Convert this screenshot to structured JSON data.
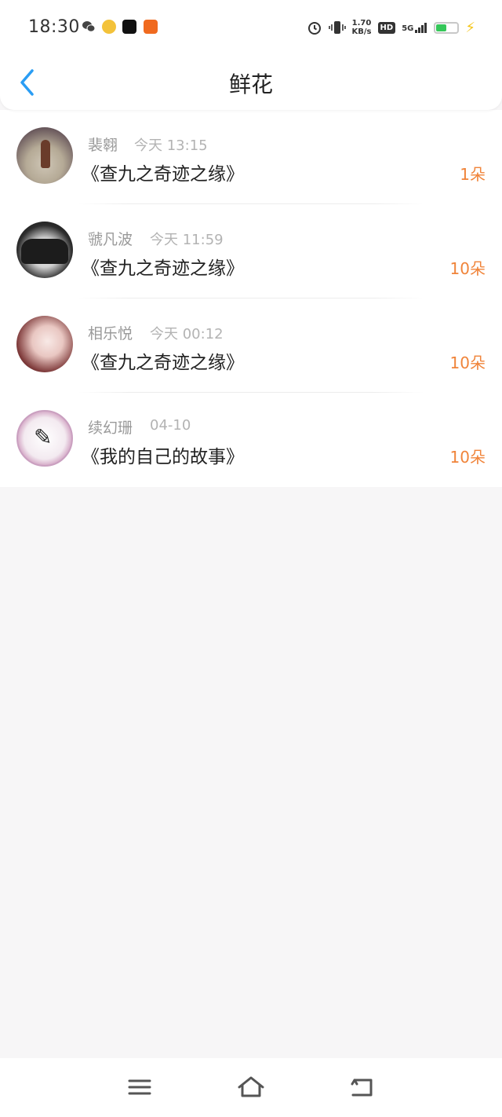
{
  "status_bar": {
    "time": "18:30",
    "net_speed_value": "1.70",
    "net_speed_unit": "KB/s",
    "hd_label": "HD",
    "signal_label": "5G"
  },
  "nav": {
    "title": "鲜花"
  },
  "items": [
    {
      "user": "裴翱",
      "time": "今天 13:15",
      "book": "《查九之奇迹之缘》",
      "count": "1朵"
    },
    {
      "user": "虢凡波",
      "time": "今天 11:59",
      "book": "《查九之奇迹之缘》",
      "count": "10朵"
    },
    {
      "user": "相乐悦",
      "time": "今天 00:12",
      "book": "《查九之奇迹之缘》",
      "count": "10朵"
    },
    {
      "user": "续幻珊",
      "time": "04-10",
      "book": "《我的自己的故事》",
      "count": "10朵"
    }
  ],
  "colors": {
    "accent_blue": "#2a9df4",
    "count_orange": "#f0843a",
    "page_bg": "#f7f6f7"
  },
  "icons": {
    "back": "chevron-left-icon",
    "menu": "menu-icon",
    "home": "home-icon",
    "return": "return-icon"
  }
}
